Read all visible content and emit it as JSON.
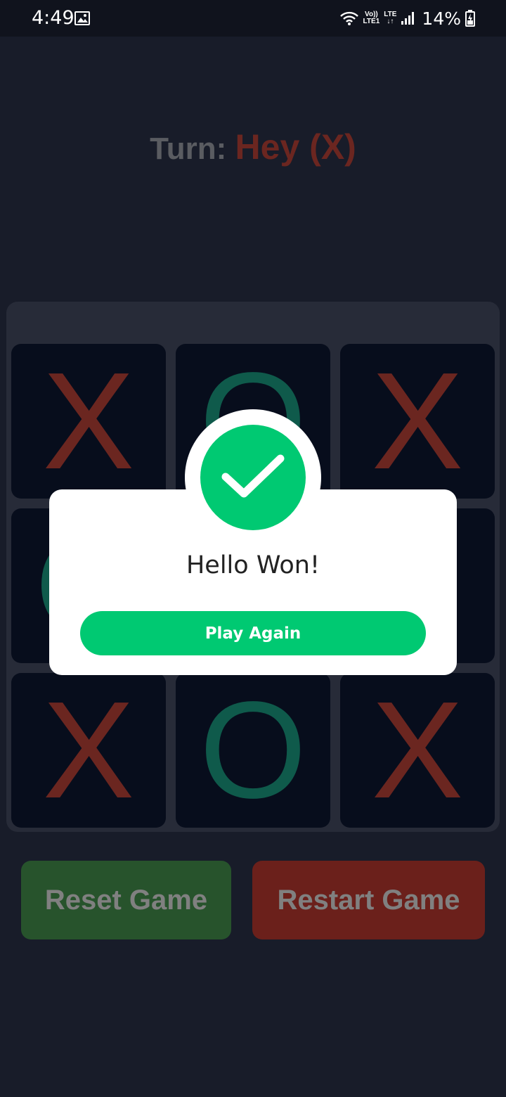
{
  "status_bar": {
    "time": "4:49",
    "network_volte": "Vo))",
    "network_lte1": "LTE1",
    "network_lte": "LTE",
    "battery": "14%"
  },
  "turn": {
    "label": "Turn:",
    "player": "Hey (X)"
  },
  "board": {
    "cells": [
      "X",
      "O",
      "X",
      "O",
      "",
      "",
      "X",
      "O",
      "X"
    ]
  },
  "buttons": {
    "reset": "Reset Game",
    "restart": "Restart Game"
  },
  "modal": {
    "title": "Hello Won!",
    "action": "Play Again",
    "icon": "check-icon"
  },
  "colors": {
    "background": "#181c29",
    "x_mark": "#6b2620",
    "o_mark": "#0f5a4b",
    "accent": "#00c972"
  }
}
